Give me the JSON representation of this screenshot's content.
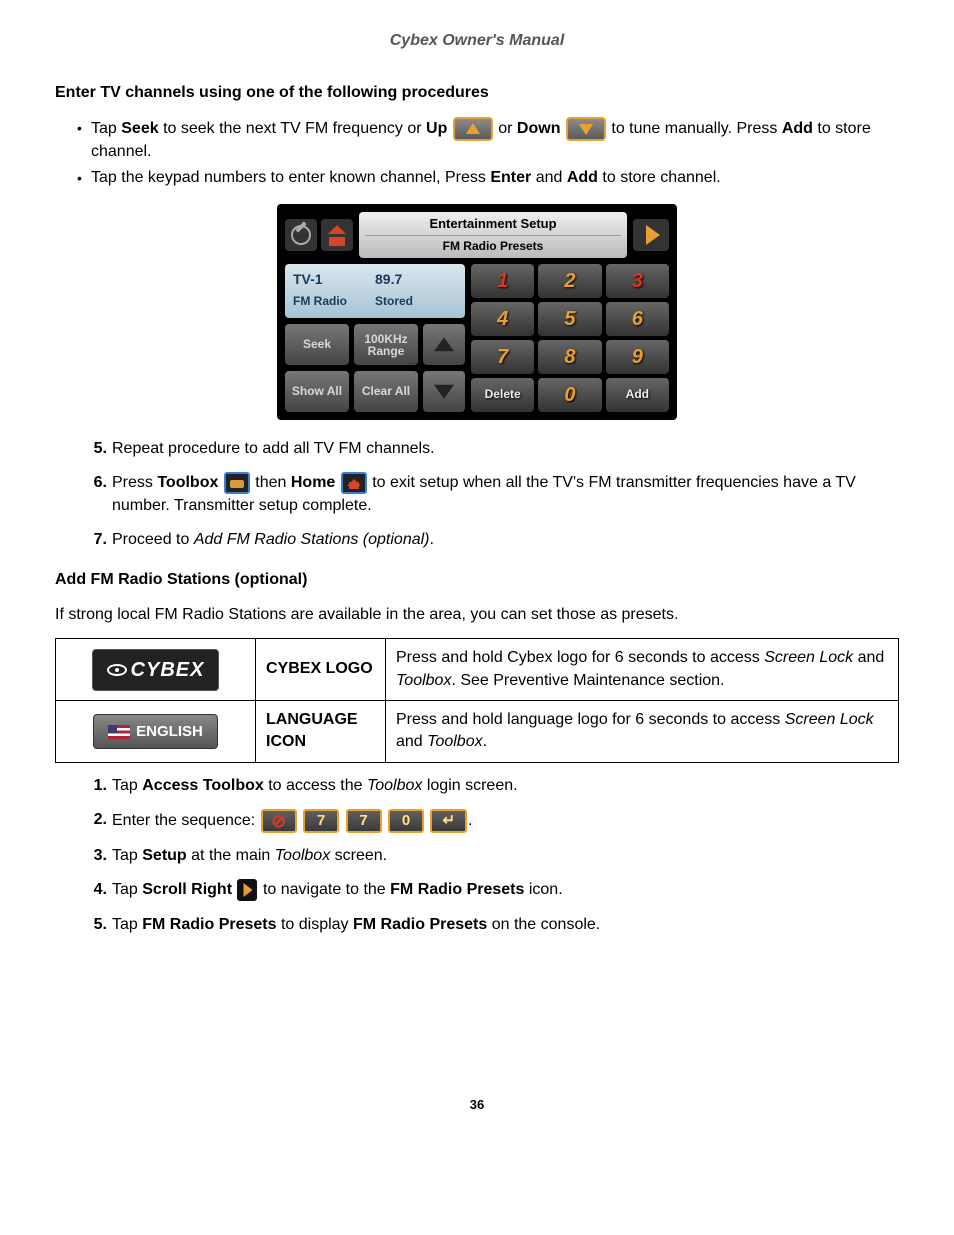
{
  "docTitle": "Cybex Owner's Manual",
  "h1": "Enter TV channels using one of the following procedures",
  "bullet1_p1": "Tap ",
  "bullet1_b1": "Seek",
  "bullet1_p2": " to seek the next TV FM frequency or ",
  "bullet1_b2": "Up",
  "bullet1_p3": " or ",
  "bullet1_b3": "Down",
  "bullet1_p4": " to tune manually. Press ",
  "bullet1_b4": "Add",
  "bullet1_p5": " to store channel.",
  "bullet2_p1": "Tap the keypad numbers to enter known channel, Press ",
  "bullet2_b1": "Enter",
  "bullet2_p2": " and ",
  "bullet2_b2": "Add",
  "bullet2_p3": " to store channel.",
  "ss": {
    "title1": "Entertainment Setup",
    "title2": "FM Radio Presets",
    "tv": "TV-1",
    "freq": "89.7",
    "band": "FM Radio",
    "stat": "Stored",
    "seek": "Seek",
    "range1": "100KHz",
    "range2": "Range",
    "showAll": "Show All",
    "clearAll": "Clear All",
    "k1": "1",
    "k2": "2",
    "k3": "3",
    "k4": "4",
    "k5": "5",
    "k6": "6",
    "k7": "7",
    "k8": "8",
    "k9": "9",
    "k0": "0",
    "del": "Delete",
    "add": "Add"
  },
  "step5_num": "5.",
  "step5": "Repeat procedure to add all TV FM channels.",
  "step6_num": "6.",
  "step6_p1": "Press ",
  "step6_b1": "Toolbox",
  "step6_p2": " then ",
  "step6_b2": "Home",
  "step6_p3": " to exit setup when all the TV's FM transmitter frequencies have a TV number. Transmitter setup complete.",
  "step7_num": "7.",
  "step7_p1": "Proceed to ",
  "step7_i1": "Add FM Radio Stations (optional)",
  "step7_p2": ".",
  "h2": "Add FM Radio Stations (optional)",
  "para1": "If strong local FM Radio Stations are available in the area, you can set those as presets.",
  "table": {
    "cybexLogo": "CYBEX",
    "row1col2": "CYBEX LOGO",
    "row1col3_p1": "Press and hold Cybex logo for 6 seconds to access ",
    "row1col3_i1": "Screen Lock",
    "row1col3_p2": " and ",
    "row1col3_i2": "Toolbox",
    "row1col3_p3": ". See Preventive Maintenance section.",
    "englishLogo": "ENGLISH",
    "row2col2": "LANGUAGE ICON",
    "row2col3_p1": "Press and hold language logo for 6 seconds to access ",
    "row2col3_i1": "Screen Lock",
    "row2col3_p2": " and ",
    "row2col3_i2": "Toolbox",
    "row2col3_p3": "."
  },
  "s1_num": "1.",
  "s1_p1": "Tap ",
  "s1_b1": "Access Toolbox",
  "s1_p2": " to access the ",
  "s1_i1": "Toolbox",
  "s1_p3": " login screen.",
  "s2_num": "2.",
  "s2_p1": "Enter the sequence: ",
  "seqKeys": {
    "k1": "⊘",
    "k2": "7",
    "k3": "7",
    "k4": "0",
    "k5": "↵"
  },
  "s2_p2": ".",
  "s3_num": "3.",
  "s3_p1": "Tap ",
  "s3_b1": "Setup",
  "s3_p2": " at the main ",
  "s3_i1": "Toolbox",
  "s3_p3": " screen.",
  "s4_num": "4.",
  "s4_p1": "Tap ",
  "s4_b1": "Scroll Right",
  "s4_p2": " to navigate to the ",
  "s4_b2": "FM Radio Presets",
  "s4_p3": " icon.",
  "s5_num": "5.",
  "s5_p1": "Tap ",
  "s5_b1": "FM Radio Presets",
  "s5_p2": " to display ",
  "s5_b2": "FM Radio Presets",
  "s5_p3": " on the console.",
  "pageNum": "36"
}
